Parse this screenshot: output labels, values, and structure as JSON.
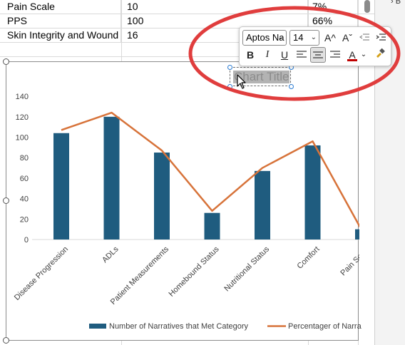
{
  "sheet": {
    "rows": [
      {
        "label": "Pain Scale",
        "value": "10",
        "percent": "7%"
      },
      {
        "label": "PPS",
        "value": "100",
        "percent": "66%"
      },
      {
        "label": "Skin Integrity and Wound",
        "value": "16",
        "percent": ""
      }
    ]
  },
  "side_pane": {
    "glyph": "› B"
  },
  "mini_toolbar": {
    "font_name": "Aptos Na",
    "font_size": "14",
    "grow_font": "A^",
    "shrink_font": "Aˇ",
    "bold": "B",
    "italic": "I",
    "underline": "U",
    "font_color": "A",
    "font_color_hex": "#c00000"
  },
  "chart_title": "Chart Title",
  "colors": {
    "bar": "#1f5c7f",
    "line": "#d7733a",
    "annotation": "#e03d3d"
  },
  "chart_data": {
    "type": "bar",
    "categories": [
      "Disease Progression",
      "ADLs",
      "Patient Measurements",
      "Homebound Status",
      "Nutritional Status",
      "Comfort",
      "Pain Scale"
    ],
    "series": [
      {
        "name": "Number of Narratives that Met Category",
        "type": "bar",
        "values": [
          104,
          120,
          85,
          26,
          67,
          92,
          10
        ]
      },
      {
        "name": "Percentager of Narra",
        "type": "line",
        "values": [
          107,
          124,
          87,
          28,
          70,
          96,
          7
        ]
      }
    ],
    "yticks": [
      "0",
      "20",
      "40",
      "60",
      "80",
      "100",
      "120",
      "140"
    ],
    "ylim": [
      0,
      140
    ],
    "title": "Chart Title",
    "legend_position": "bottom",
    "grid": false
  }
}
